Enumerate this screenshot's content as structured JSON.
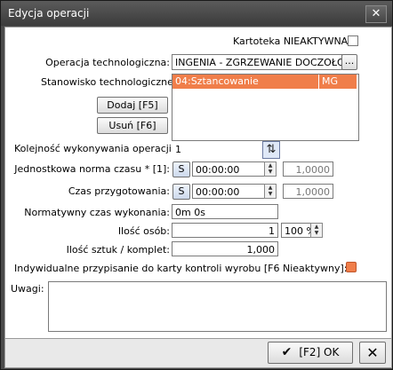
{
  "window": {
    "title": "Edycja operacji"
  },
  "kartoteka": {
    "label": "Kartoteka NIEAKTYWNA",
    "checked": false
  },
  "operacja": {
    "label": "Operacja technologiczna:",
    "value": "INGENIA - ZGRZEWANIE DOCZOŁOWE",
    "browse": "..."
  },
  "stanowisko": {
    "label": "Stanowisko technologiczne:",
    "rows": [
      {
        "name": "04:Sztancowanie",
        "code": "MG"
      }
    ]
  },
  "buttons": {
    "add": "Dodaj [F5]",
    "remove": "Usuń [F6]"
  },
  "kolejnosc": {
    "label": "Kolejność wykonywania operacji:",
    "value": "1"
  },
  "norma": {
    "label": "Jednostkowa norma czasu * [1]:",
    "s": "S",
    "value": "00:00:00",
    "right": "1,0000"
  },
  "przygotowanie": {
    "label": "Czas przygotowania:",
    "s": "S",
    "value": "00:00:00",
    "right": "1,0000"
  },
  "normatywny": {
    "label": "Normatywny czas wykonania:",
    "value": "0m 0s"
  },
  "osoby": {
    "label": "Ilość osób:",
    "value": "1",
    "percent": "100 %"
  },
  "sztuki": {
    "label": "Ilość sztuk / komplet:",
    "value": "1,000"
  },
  "indyw": {
    "label": "Indywidualne przypisanie do karty kontroli wyrobu [F6 Nieaktywny]:"
  },
  "uwagi": {
    "label": "Uwagi:",
    "value": ""
  },
  "footer": {
    "ok": "[F2] OK"
  },
  "colors": {
    "selection": "#f07e4a",
    "toggle": "#f07e4a",
    "titlebar": "#3f3f3f"
  }
}
